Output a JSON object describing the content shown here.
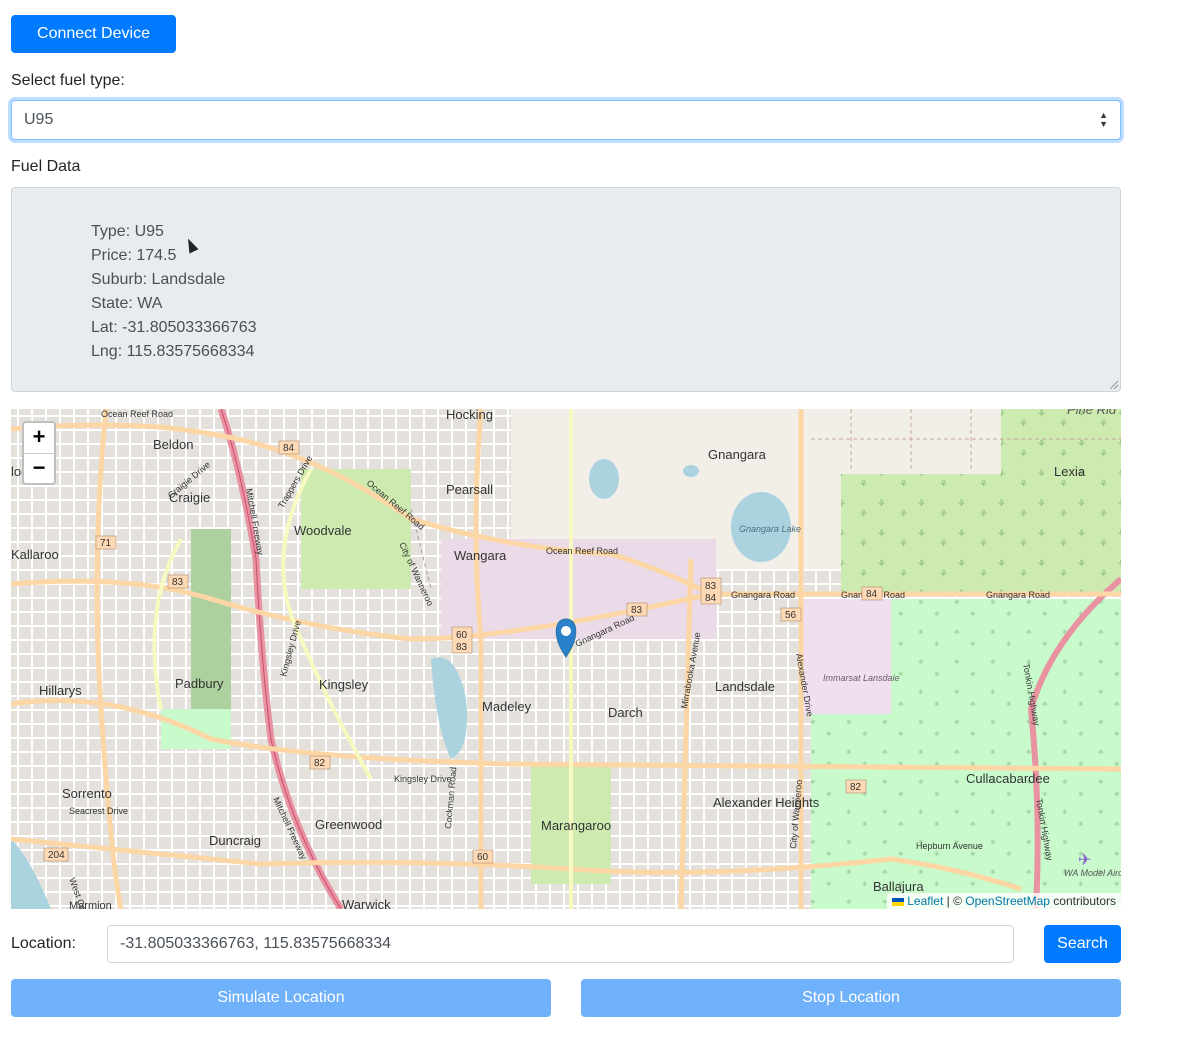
{
  "buttons": {
    "connect": "Connect Device",
    "search": "Search",
    "simulate": "Simulate Location",
    "stop": "Stop Location"
  },
  "fuel_select": {
    "label": "Select fuel type:",
    "selected": "U95"
  },
  "fuel_data": {
    "label": "Fuel Data",
    "lines": [
      "Type: U95",
      "Price: 174.5",
      "Suburb: Landsdale",
      "State: WA",
      "Lat: -31.805033366763",
      "Lng: 115.83575668334"
    ]
  },
  "location": {
    "label": "Location:",
    "value": "-31.805033366763, 115.83575668334"
  },
  "map": {
    "zoom_in": "+",
    "zoom_out": "−",
    "attribution": {
      "leaflet": "Leaflet",
      "separator": " | © ",
      "osm": "OpenStreetMap",
      "suffix": " contributors"
    },
    "places": [
      "Hocking",
      "Beldon",
      "Craigie",
      "Gnangara",
      "Lexia",
      "Pearsall",
      "Woodvale",
      "Wangara",
      "Kallaroo",
      "Gnangara Lake",
      "Immarsat Lansdale",
      "Padbury",
      "Kingsley",
      "Hillarys",
      "Madeley",
      "Darch",
      "Landsdale",
      "Cullacabardee",
      "Sorrento",
      "Greenwood",
      "Duncraig",
      "Marangaroo",
      "Alexander Heights",
      "Ballajura",
      "WA Model Aircraft",
      "Warwick",
      "Marmion",
      "Pine Rid",
      "loo"
    ],
    "roads": [
      "Ocean Reef Road",
      "Gnangara Road",
      "Mirrabooka Avenue",
      "Alexander Drive",
      "Tonkin Highway",
      "Hepburn Avenue",
      "Mitchell Freeway",
      "Trappers Drive",
      "Craigie Drive",
      "Kingsley Drive",
      "Cockman Road",
      "Blackall Drive",
      "Seacrest Drive",
      "City of Wanneroo",
      "West Coast"
    ],
    "shields": [
      "84",
      "71",
      "83",
      "60",
      "83",
      "82",
      "204",
      "83",
      "56",
      "82",
      "84",
      "60"
    ],
    "marker": {
      "lat": -31.805033366763,
      "lng": 115.83575668334,
      "color": "#2a81cb"
    }
  },
  "colors": {
    "primary": "#007bff",
    "primary_disabled": "#6fb1fb",
    "readonly_bg": "#e9ecef"
  }
}
